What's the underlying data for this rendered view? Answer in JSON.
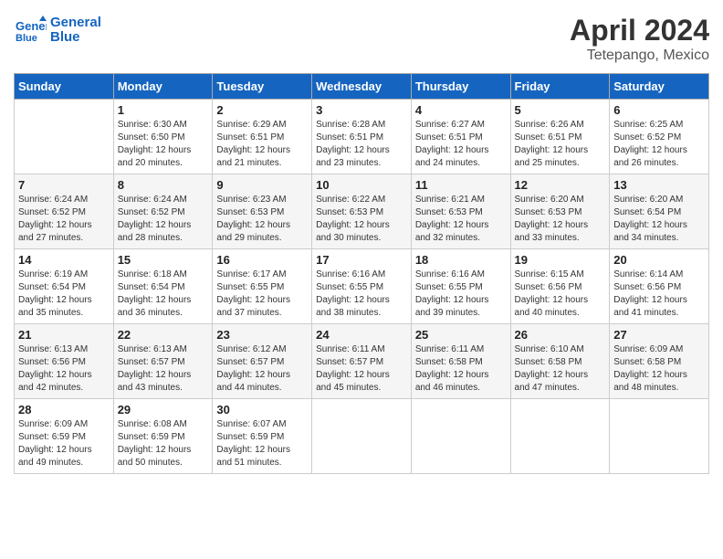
{
  "header": {
    "logo_line1": "General",
    "logo_line2": "Blue",
    "calendar_title": "April 2024",
    "calendar_subtitle": "Tetepango, Mexico"
  },
  "weekdays": [
    "Sunday",
    "Monday",
    "Tuesday",
    "Wednesday",
    "Thursday",
    "Friday",
    "Saturday"
  ],
  "weeks": [
    [
      {
        "day": "",
        "info": ""
      },
      {
        "day": "1",
        "info": "Sunrise: 6:30 AM\nSunset: 6:50 PM\nDaylight: 12 hours\nand 20 minutes."
      },
      {
        "day": "2",
        "info": "Sunrise: 6:29 AM\nSunset: 6:51 PM\nDaylight: 12 hours\nand 21 minutes."
      },
      {
        "day": "3",
        "info": "Sunrise: 6:28 AM\nSunset: 6:51 PM\nDaylight: 12 hours\nand 23 minutes."
      },
      {
        "day": "4",
        "info": "Sunrise: 6:27 AM\nSunset: 6:51 PM\nDaylight: 12 hours\nand 24 minutes."
      },
      {
        "day": "5",
        "info": "Sunrise: 6:26 AM\nSunset: 6:51 PM\nDaylight: 12 hours\nand 25 minutes."
      },
      {
        "day": "6",
        "info": "Sunrise: 6:25 AM\nSunset: 6:52 PM\nDaylight: 12 hours\nand 26 minutes."
      }
    ],
    [
      {
        "day": "7",
        "info": "Sunrise: 6:24 AM\nSunset: 6:52 PM\nDaylight: 12 hours\nand 27 minutes."
      },
      {
        "day": "8",
        "info": "Sunrise: 6:24 AM\nSunset: 6:52 PM\nDaylight: 12 hours\nand 28 minutes."
      },
      {
        "day": "9",
        "info": "Sunrise: 6:23 AM\nSunset: 6:53 PM\nDaylight: 12 hours\nand 29 minutes."
      },
      {
        "day": "10",
        "info": "Sunrise: 6:22 AM\nSunset: 6:53 PM\nDaylight: 12 hours\nand 30 minutes."
      },
      {
        "day": "11",
        "info": "Sunrise: 6:21 AM\nSunset: 6:53 PM\nDaylight: 12 hours\nand 32 minutes."
      },
      {
        "day": "12",
        "info": "Sunrise: 6:20 AM\nSunset: 6:53 PM\nDaylight: 12 hours\nand 33 minutes."
      },
      {
        "day": "13",
        "info": "Sunrise: 6:20 AM\nSunset: 6:54 PM\nDaylight: 12 hours\nand 34 minutes."
      }
    ],
    [
      {
        "day": "14",
        "info": "Sunrise: 6:19 AM\nSunset: 6:54 PM\nDaylight: 12 hours\nand 35 minutes."
      },
      {
        "day": "15",
        "info": "Sunrise: 6:18 AM\nSunset: 6:54 PM\nDaylight: 12 hours\nand 36 minutes."
      },
      {
        "day": "16",
        "info": "Sunrise: 6:17 AM\nSunset: 6:55 PM\nDaylight: 12 hours\nand 37 minutes."
      },
      {
        "day": "17",
        "info": "Sunrise: 6:16 AM\nSunset: 6:55 PM\nDaylight: 12 hours\nand 38 minutes."
      },
      {
        "day": "18",
        "info": "Sunrise: 6:16 AM\nSunset: 6:55 PM\nDaylight: 12 hours\nand 39 minutes."
      },
      {
        "day": "19",
        "info": "Sunrise: 6:15 AM\nSunset: 6:56 PM\nDaylight: 12 hours\nand 40 minutes."
      },
      {
        "day": "20",
        "info": "Sunrise: 6:14 AM\nSunset: 6:56 PM\nDaylight: 12 hours\nand 41 minutes."
      }
    ],
    [
      {
        "day": "21",
        "info": "Sunrise: 6:13 AM\nSunset: 6:56 PM\nDaylight: 12 hours\nand 42 minutes."
      },
      {
        "day": "22",
        "info": "Sunrise: 6:13 AM\nSunset: 6:57 PM\nDaylight: 12 hours\nand 43 minutes."
      },
      {
        "day": "23",
        "info": "Sunrise: 6:12 AM\nSunset: 6:57 PM\nDaylight: 12 hours\nand 44 minutes."
      },
      {
        "day": "24",
        "info": "Sunrise: 6:11 AM\nSunset: 6:57 PM\nDaylight: 12 hours\nand 45 minutes."
      },
      {
        "day": "25",
        "info": "Sunrise: 6:11 AM\nSunset: 6:58 PM\nDaylight: 12 hours\nand 46 minutes."
      },
      {
        "day": "26",
        "info": "Sunrise: 6:10 AM\nSunset: 6:58 PM\nDaylight: 12 hours\nand 47 minutes."
      },
      {
        "day": "27",
        "info": "Sunrise: 6:09 AM\nSunset: 6:58 PM\nDaylight: 12 hours\nand 48 minutes."
      }
    ],
    [
      {
        "day": "28",
        "info": "Sunrise: 6:09 AM\nSunset: 6:59 PM\nDaylight: 12 hours\nand 49 minutes."
      },
      {
        "day": "29",
        "info": "Sunrise: 6:08 AM\nSunset: 6:59 PM\nDaylight: 12 hours\nand 50 minutes."
      },
      {
        "day": "30",
        "info": "Sunrise: 6:07 AM\nSunset: 6:59 PM\nDaylight: 12 hours\nand 51 minutes."
      },
      {
        "day": "",
        "info": ""
      },
      {
        "day": "",
        "info": ""
      },
      {
        "day": "",
        "info": ""
      },
      {
        "day": "",
        "info": ""
      }
    ]
  ]
}
